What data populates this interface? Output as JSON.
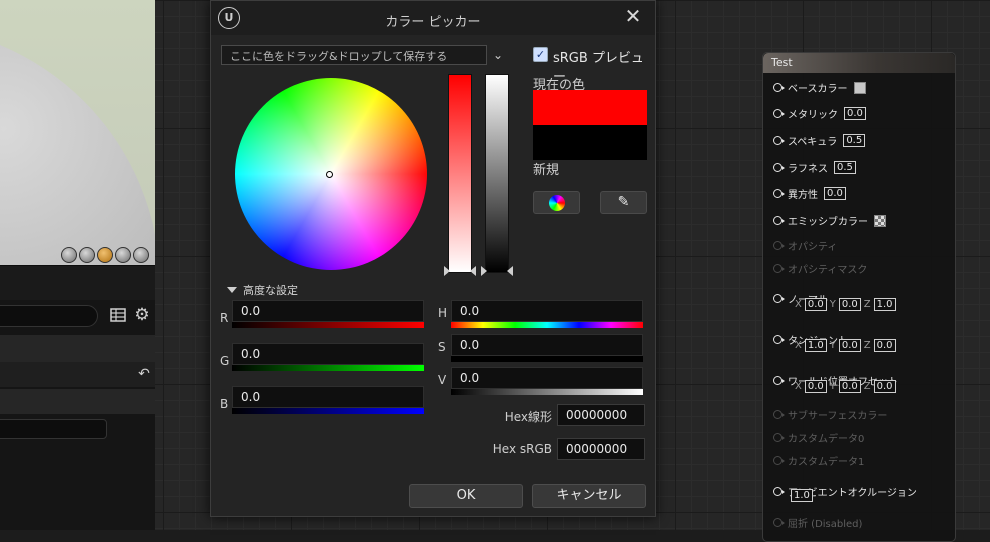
{
  "dialog": {
    "title": "カラー ピッカー",
    "logo_text": "U",
    "close_symbol": "✕",
    "drop_area_text": "ここに色をドラッグ&ドロップして保存する",
    "srgb_preview_label": "sRGB プレビュー",
    "srgb_preview_checked": true,
    "current_color_label": "現在の色",
    "new_color_label": "新規",
    "current_color": "#ff0000",
    "new_color": "#000000",
    "advanced_label": "高度な設定",
    "channels_rgb": [
      {
        "label": "R",
        "value": "0.0"
      },
      {
        "label": "G",
        "value": "0.0"
      },
      {
        "label": "B",
        "value": "0.0"
      }
    ],
    "channels_hsv": [
      {
        "label": "H",
        "value": "0.0"
      },
      {
        "label": "S",
        "value": "0.0"
      },
      {
        "label": "V",
        "value": "0.0"
      }
    ],
    "hex_linear_label": "Hex線形",
    "hex_linear_value": "00000000",
    "hex_srgb_label": "Hex sRGB",
    "hex_srgb_value": "00000000",
    "ok_label": "OK",
    "cancel_label": "キャンセル"
  },
  "node": {
    "title": "Test",
    "pins": [
      {
        "label": "ベースカラー",
        "value": "",
        "enabled": true
      },
      {
        "label": "メタリック",
        "value": "0.0",
        "enabled": true
      },
      {
        "label": "スペキュラ",
        "value": "0.5",
        "enabled": true
      },
      {
        "label": "ラフネス",
        "value": "0.5",
        "enabled": true
      },
      {
        "label": "異方性",
        "value": "0.0",
        "enabled": true
      },
      {
        "label": "エミッシブカラー",
        "value": "",
        "enabled": true
      },
      {
        "label": "オパシティ",
        "value": "",
        "enabled": false
      },
      {
        "label": "オパシティマスク",
        "value": "",
        "enabled": false
      },
      {
        "label": "ノーマル",
        "x": "0.0",
        "y": "0.0",
        "z": "1.0",
        "enabled": true
      },
      {
        "label": "タンジェント",
        "x": "1.0",
        "y": "0.0",
        "z": "0.0",
        "enabled": true
      },
      {
        "label": "ワールド位置オフセット",
        "x": "0.0",
        "y": "0.0",
        "z": "0.0",
        "enabled": true
      },
      {
        "label": "サブサーフェスカラー",
        "value": "",
        "enabled": false
      },
      {
        "label": "カスタムデータ0",
        "value": "",
        "enabled": false
      },
      {
        "label": "カスタムデータ1",
        "value": "",
        "enabled": false
      },
      {
        "label": "アンビエントオクルージョン",
        "value": "1.0",
        "enabled": true
      },
      {
        "label": "屈折 (Disabled)",
        "value": "",
        "enabled": false
      }
    ],
    "axis_x": "X",
    "axis_y": "Y",
    "axis_z": "Z"
  },
  "icons": {
    "gear": "⚙",
    "undo": "↶",
    "eyedropper": "✎",
    "chevron": "⌄"
  }
}
